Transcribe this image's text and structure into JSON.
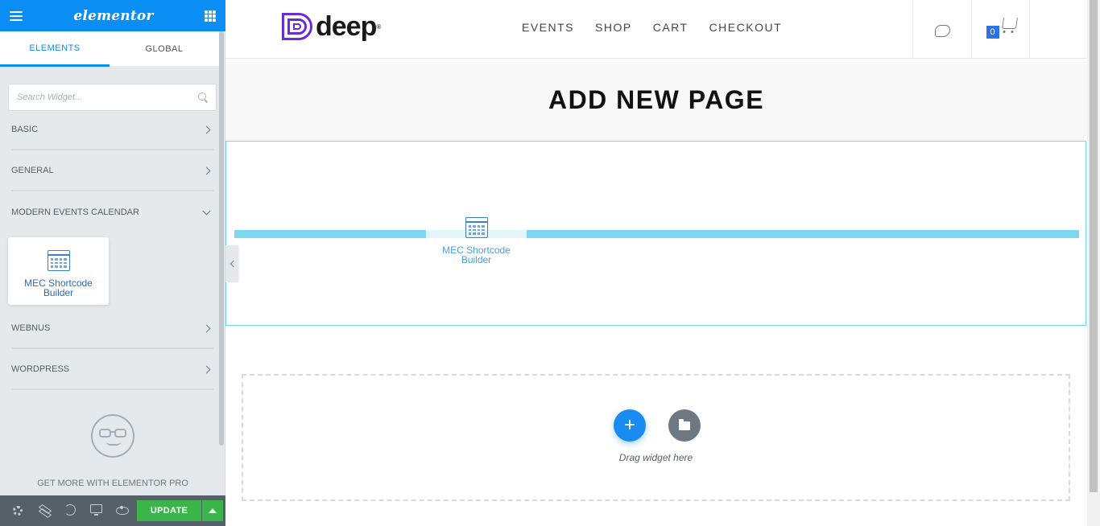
{
  "panel": {
    "logo": "elementor",
    "tabs": [
      "ELEMENTS",
      "GLOBAL"
    ],
    "search_placeholder": "Search Widget...",
    "categories": [
      {
        "label": "BASIC",
        "state": "collapsed"
      },
      {
        "label": "GENERAL",
        "state": "collapsed"
      },
      {
        "label": "MODERN EVENTS CALENDAR",
        "state": "expanded"
      },
      {
        "label": "WEBNUS",
        "state": "collapsed"
      },
      {
        "label": "WORDPRESS",
        "state": "collapsed"
      }
    ],
    "widget": {
      "label": "MEC Shortcode Builder",
      "icon": "calendar-grid-icon"
    },
    "promo": "GET MORE WITH ELEMENTOR PRO",
    "update_label": "UPDATE"
  },
  "site": {
    "brand": "deep",
    "brand_mark": "®",
    "nav": [
      "EVENTS",
      "SHOP",
      "CART",
      "CHECKOUT"
    ],
    "cart_count": "0",
    "page_title": "ADD NEW PAGE",
    "dragged_widget": "MEC Shortcode Builder",
    "drag_hint": "Drag widget here"
  },
  "colors": {
    "accent": "#0a8ef4",
    "update": "#39b54a",
    "brand": "#6b2bd8",
    "drop_indicator": "#7ed7f2"
  }
}
